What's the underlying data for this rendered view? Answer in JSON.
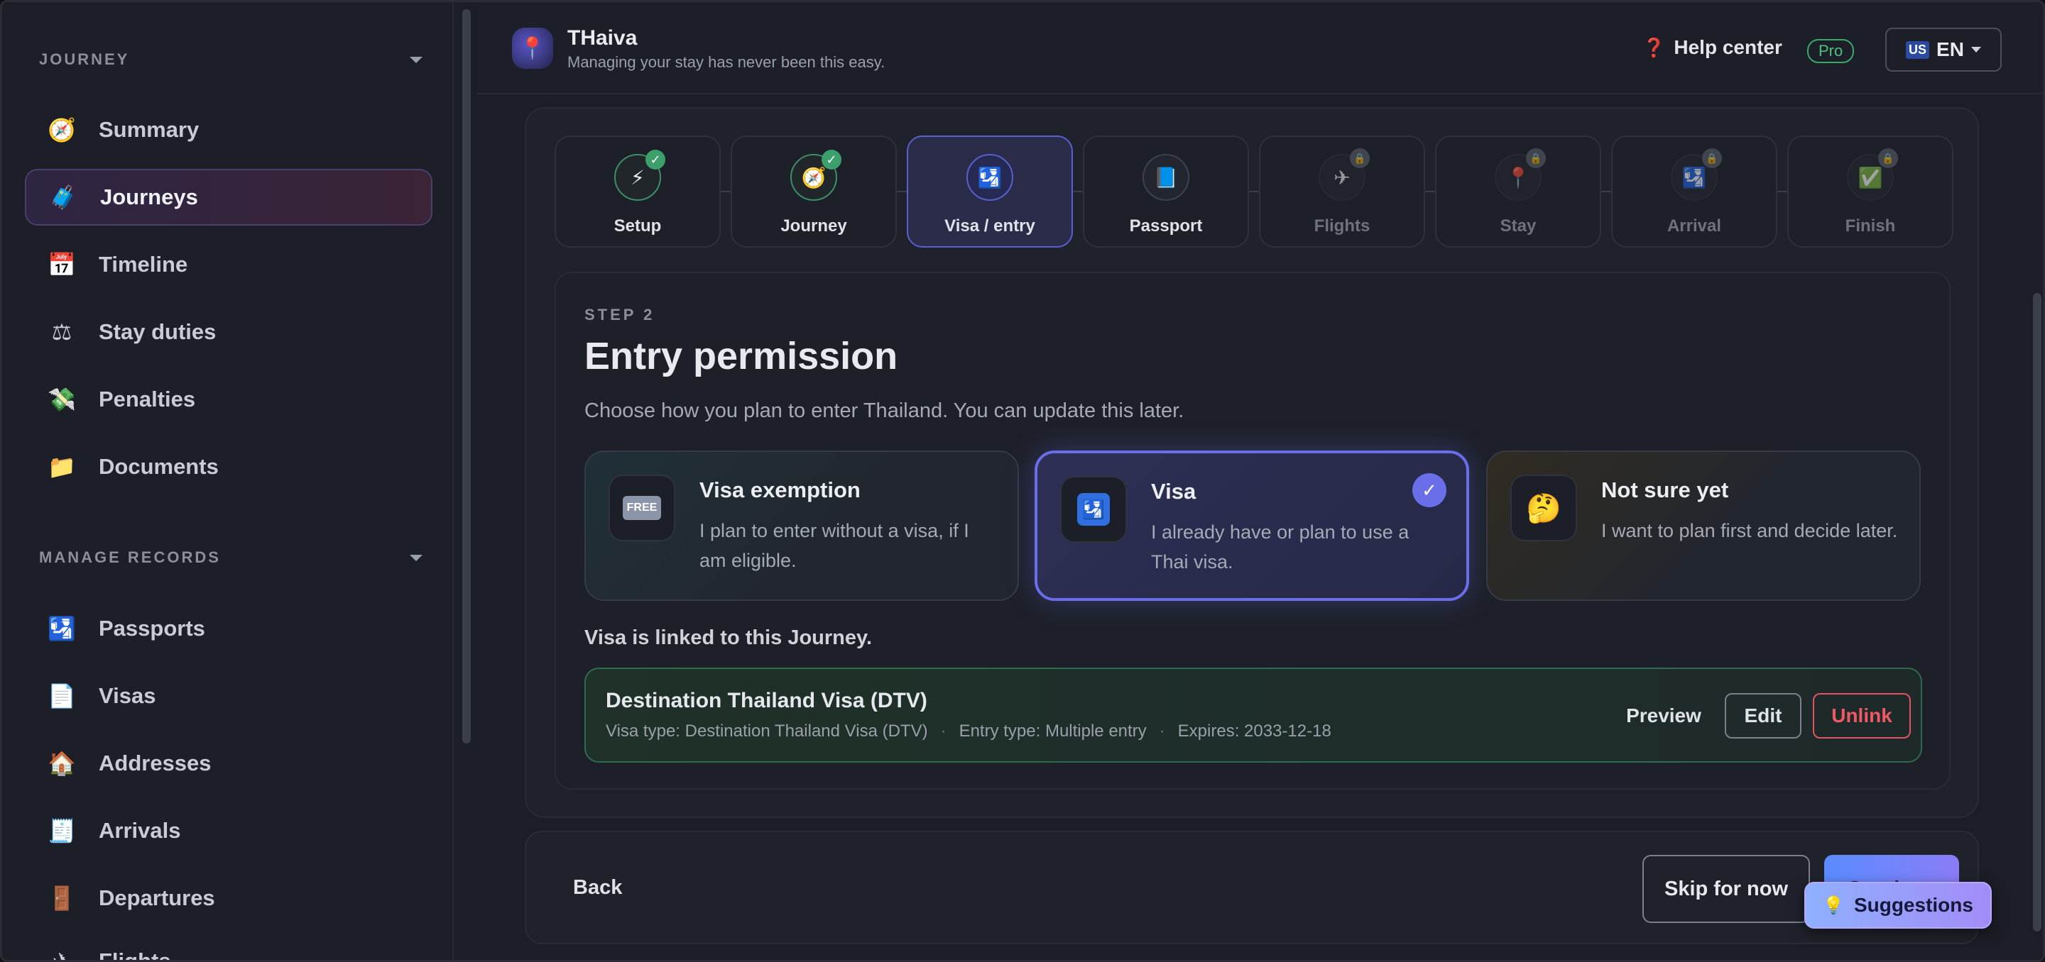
{
  "app": {
    "title": "THaiva",
    "subtitle": "Managing your stay has never been this easy."
  },
  "topbar": {
    "help": "Help center",
    "pro": "Pro",
    "lang": "EN",
    "flag": "US"
  },
  "sidebar": {
    "journey_section": "JOURNEY",
    "journey_items": [
      {
        "label": "Summary",
        "icon": "compass-icon"
      },
      {
        "label": "Journeys",
        "icon": "luggage-icon",
        "active": true
      },
      {
        "label": "Timeline",
        "icon": "calendar-icon"
      },
      {
        "label": "Stay duties",
        "icon": "scales-icon"
      },
      {
        "label": "Penalties",
        "icon": "money-icon"
      },
      {
        "label": "Documents",
        "icon": "folder-icon"
      }
    ],
    "records_section": "MANAGE RECORDS",
    "records_items": [
      {
        "label": "Passports",
        "icon": "passport-icon"
      },
      {
        "label": "Visas",
        "icon": "document-icon"
      },
      {
        "label": "Addresses",
        "icon": "house-icon"
      },
      {
        "label": "Arrivals",
        "icon": "receipt-icon"
      },
      {
        "label": "Departures",
        "icon": "door-icon"
      },
      {
        "label": "Flights",
        "icon": "airplane-icon"
      }
    ]
  },
  "steps": [
    {
      "label": "Setup",
      "icon": "⚡",
      "status": "done"
    },
    {
      "label": "Journey",
      "icon": "🧭",
      "status": "done"
    },
    {
      "label": "Visa / entry",
      "icon": "🛂",
      "status": "current"
    },
    {
      "label": "Passport",
      "icon": "📘",
      "status": "pending"
    },
    {
      "label": "Flights",
      "icon": "✈",
      "status": "locked"
    },
    {
      "label": "Stay",
      "icon": "📍",
      "status": "locked"
    },
    {
      "label": "Arrival",
      "icon": "🛂",
      "status": "locked"
    },
    {
      "label": "Finish",
      "icon": "✅",
      "status": "locked"
    }
  ],
  "entry": {
    "step_label": "STEP 2",
    "title": "Entry permission",
    "description": "Choose how you plan to enter Thailand. You can update this later.",
    "options": [
      {
        "title": "Visa exemption",
        "text": "I plan to enter without a visa, if I am eligible.",
        "icon": "free-icon"
      },
      {
        "title": "Visa",
        "text": "I already have or plan to use a Thai visa.",
        "icon": "passport-control-icon",
        "selected": true
      },
      {
        "title": "Not sure yet",
        "text": "I want to plan first and decide later.",
        "icon": "thinking-face-icon"
      }
    ],
    "linked_label": "Visa is linked to this Journey.",
    "linked": {
      "title": "Destination Thailand Visa (DTV)",
      "visa_type": "Visa type: Destination Thailand Visa (DTV)",
      "entry_type": "Entry type: Multiple entry",
      "expires": "Expires: 2033-12-18",
      "preview": "Preview",
      "edit": "Edit",
      "unlink": "Unlink"
    }
  },
  "footer": {
    "back": "Back",
    "skip": "Skip for now",
    "continue": "Continue",
    "suggestions": "Suggestions"
  },
  "colors": {
    "accent": "#6a6ee8",
    "success": "#3d9f6b",
    "danger": "#e2535d",
    "background": "#1b1e26"
  }
}
